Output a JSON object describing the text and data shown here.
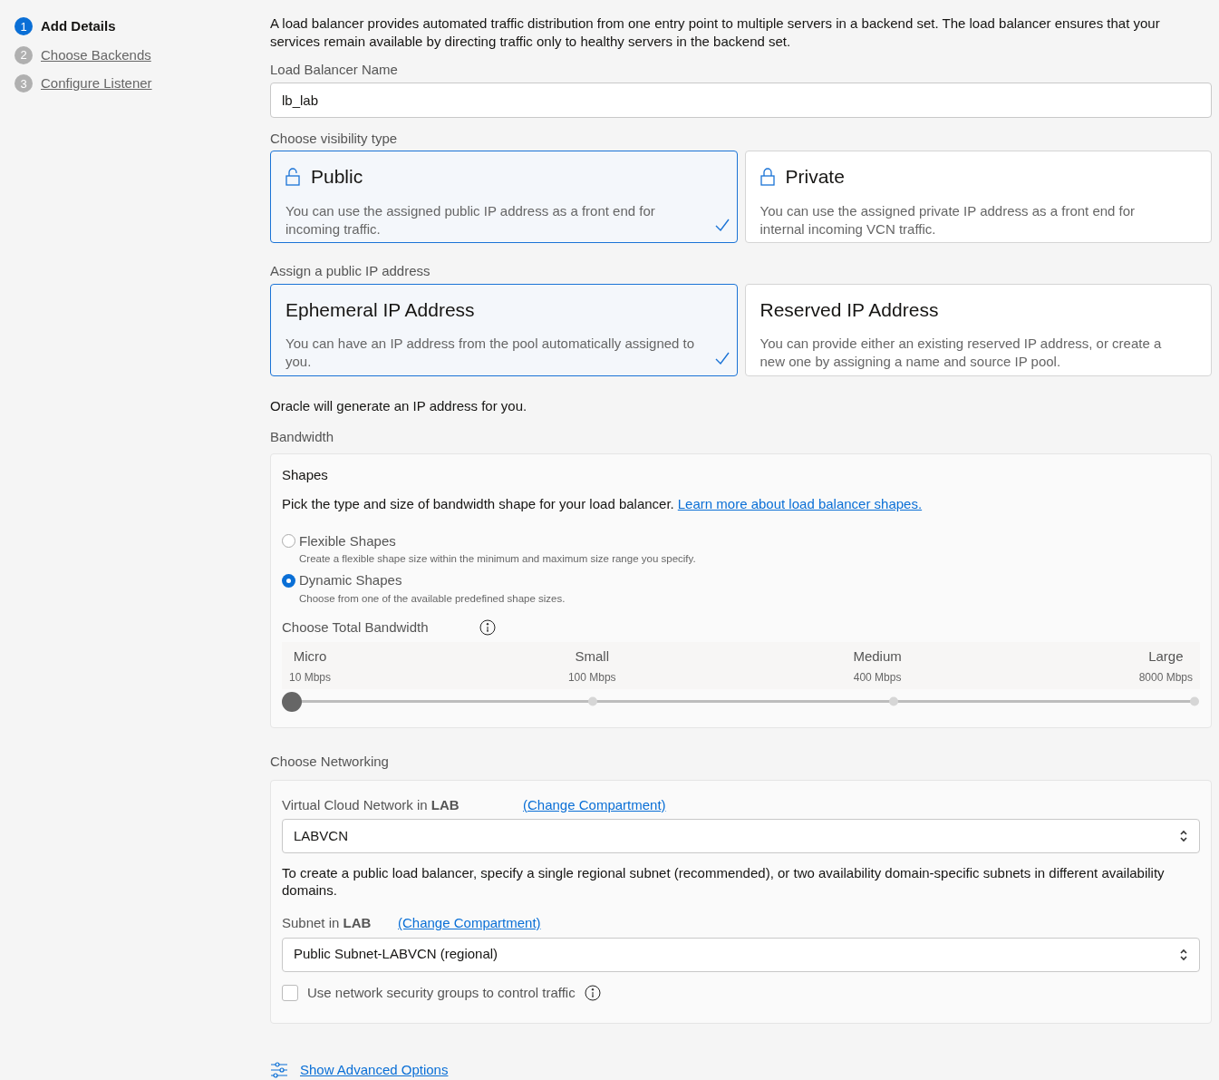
{
  "steps": [
    {
      "number": "1",
      "label": "Add Details",
      "selected": true
    },
    {
      "number": "2",
      "label": "Choose Backends",
      "selected": false
    },
    {
      "number": "3",
      "label": "Configure Listener",
      "selected": false
    }
  ],
  "intro": "A load balancer provides automated traffic distribution from one entry point to multiple servers in a backend set. The load balancer ensures that your services remain available by directing traffic only to healthy servers in the backend set.",
  "name_field": {
    "label": "Load Balancer Name",
    "value": "lb_lab"
  },
  "visibility": {
    "label": "Choose visibility type",
    "options": [
      {
        "kind": "open",
        "title": "Public",
        "description": "You can use the assigned public IP address as a front end for incoming traffic.",
        "selected": true
      },
      {
        "kind": "closed",
        "title": "Private",
        "description": "You can use the assigned private IP address as a front end for internal incoming VCN traffic.",
        "selected": false
      }
    ]
  },
  "ip": {
    "label": "Assign a public IP address",
    "options": [
      {
        "title": "Ephemeral IP Address",
        "description": "You can have an IP address from the pool automatically assigned to you.",
        "selected": true
      },
      {
        "title": "Reserved IP Address",
        "description": "You can provide either an existing reserved IP address, or create a new one by assigning a name and source IP pool.",
        "selected": false
      }
    ],
    "note": "Oracle will generate an IP address for you."
  },
  "bandwidth": {
    "label": "Bandwidth",
    "title": "Shapes",
    "description": "Pick the type and size of bandwidth shape for your load balancer.",
    "link": "Learn more about load balancer shapes.",
    "shapes": [
      {
        "label": "Flexible Shapes",
        "hint": "Create a flexible shape size within the minimum and maximum size range you specify.",
        "selected": false
      },
      {
        "label": "Dynamic Shapes",
        "hint": "Choose from one of the available predefined shape sizes.",
        "selected": true
      }
    ],
    "slider_label": "Choose Total Bandwidth",
    "stops": [
      {
        "name": "Micro",
        "speed": "10 Mbps"
      },
      {
        "name": "Small",
        "speed": "100 Mbps"
      },
      {
        "name": "Medium",
        "speed": "400 Mbps"
      },
      {
        "name": "Large",
        "speed": "8000 Mbps"
      }
    ],
    "level": 0
  },
  "networking": {
    "label": "Choose Networking",
    "vcn": {
      "label": "Virtual Cloud Network in ",
      "compartment": "LAB",
      "link": "(Change Compartment)",
      "value": "LABVCN"
    },
    "help": "To create a public load balancer, specify a single regional subnet (recommended), or two availability domain-specific subnets in different availability domains.",
    "subnet": {
      "label": "Subnet in ",
      "compartment": "LAB",
      "link": "(Change Compartment)",
      "value": "Public Subnet-LABVCN (regional)"
    },
    "nsg": {
      "label": "Use network security groups to control traffic",
      "checked": false
    }
  },
  "advanced": "Show Advanced Options"
}
